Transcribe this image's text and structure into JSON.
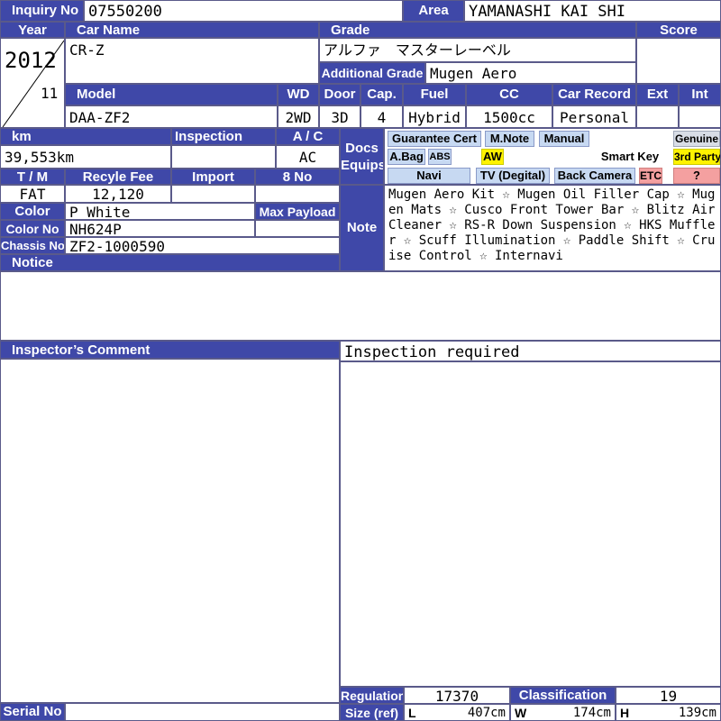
{
  "header": {
    "inquiry_no_label": "Inquiry No",
    "inquiry_no": "07550200",
    "area_label": "Area",
    "area": "YAMANASHI KAI SHI"
  },
  "row1": {
    "year_label": "Year",
    "car_name_label": "Car Name",
    "grade_label": "Grade",
    "score_label": "Score",
    "year": "2012",
    "month": "11",
    "car_name": "CR-Z",
    "grade": "アルファ　マスターレーベル",
    "additional_grade_label": "Additional Grade",
    "additional_grade": "Mugen Aero",
    "score": ""
  },
  "row2": {
    "model_label": "Model",
    "wd_label": "WD",
    "door_label": "Door",
    "cap_label": "Cap.",
    "fuel_label": "Fuel",
    "cc_label": "CC",
    "car_record_label": "Car Record",
    "ext_label": "Ext",
    "int_label": "Int",
    "model": "DAA-ZF2",
    "wd": "2WD",
    "door": "3D",
    "cap": "4",
    "fuel": "Hybrid",
    "cc": "1500cc",
    "car_record": "Personal",
    "ext": "",
    "int": ""
  },
  "left": {
    "km_label": "km",
    "inspection_label": "Inspection",
    "ac_label": "A / C",
    "km": "39,553km",
    "inspection": "",
    "ac": "AC",
    "tm_label": "T / M",
    "recycle_fee_label": "Recyle Fee",
    "import_label": "Import",
    "eight_no_label": "8 No",
    "tm": "FAT",
    "recycle_fee": "12,120",
    "import": "",
    "eight_no": "",
    "color_label": "Color",
    "color": "P White",
    "max_payload_label": "Max Payload",
    "max_payload": "",
    "color_no_label": "Color No",
    "color_no": "NH624P",
    "chassis_no_label": "Chassis No",
    "chassis_no": "ZF2-1000590",
    "notice_label": "Notice"
  },
  "docs": {
    "label_top": "Docs",
    "label_bottom": "Equips",
    "items": {
      "guarantee_cert": "Guarantee Cert",
      "m_note": "M.Note",
      "manual": "Manual",
      "genuine": "Genuine",
      "a_bag": "A.Bag",
      "abs": "ABS",
      "aw": "AW",
      "smart_key": "Smart Key",
      "third_party": "3rd Party",
      "navi": "Navi",
      "tv": "TV (Degital)",
      "back_camera": "Back Camera",
      "etc": "ETC",
      "unknown": "?"
    },
    "colors": {
      "active": "#c7d9f2",
      "highlight": "#fff200",
      "alert": "#f4a0a0",
      "inactive": "#d8dde6"
    }
  },
  "note": {
    "label": "Note",
    "text": "Mugen Aero Kit ☆ Mugen Oil Filler Cap ☆ Mugen Mats ☆ Cusco Front Tower Bar ☆ Blitz Air Cleaner ☆ RS-R Down Suspension ☆ HKS Muffler ☆ Scuff Illumination ☆ Paddle Shift ☆ Cruise Control ☆ Internavi"
  },
  "inspector": {
    "label": "Inspector’s Comment",
    "comment": "Inspection required"
  },
  "footer": {
    "regulation_label": "Regulation",
    "regulation": "17370",
    "classification_label": "Classification",
    "classification": "19",
    "size_label": "Size (ref)",
    "l_label": "L",
    "l_value": "407cm",
    "w_label": "W",
    "w_value": "174cm",
    "h_label": "H",
    "h_value": "139cm",
    "serial_no_label": "Serial No",
    "serial_no": ""
  },
  "theme": {
    "header_bg": "#3f48a8",
    "header_text": "#ffffff",
    "border": "#5a5a8a"
  }
}
